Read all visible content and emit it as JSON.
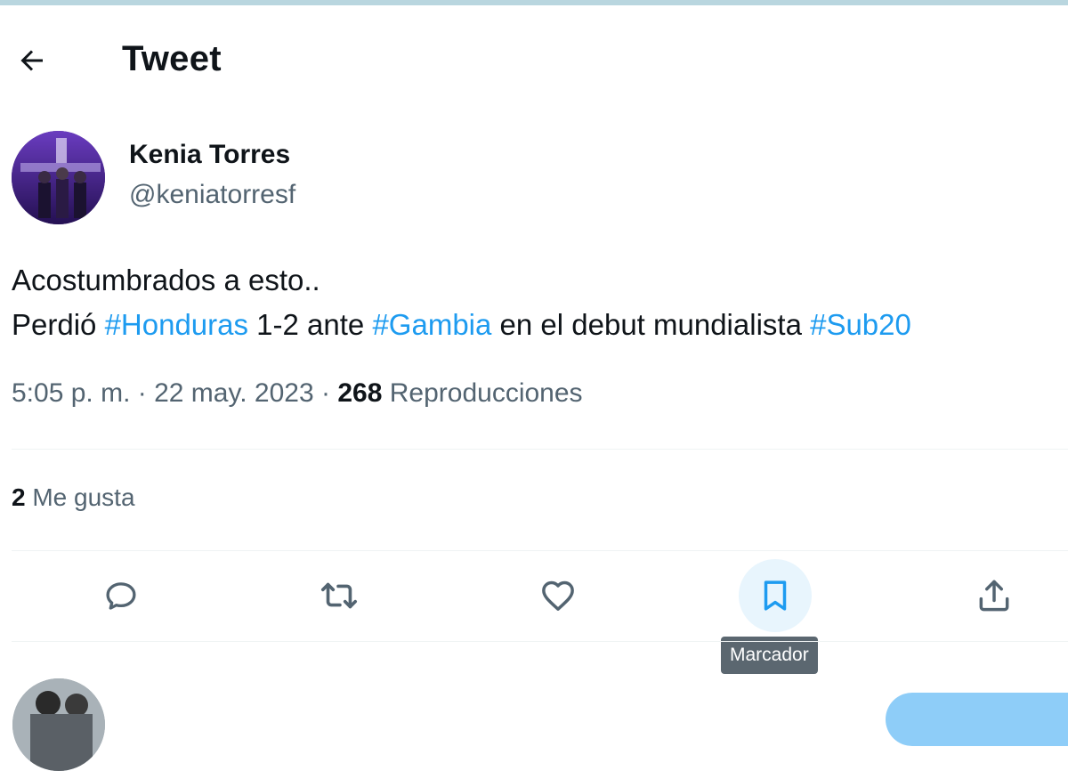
{
  "header": {
    "title": "Tweet"
  },
  "tweet": {
    "author": {
      "name": "Kenia Torres",
      "handle": "@keniatorresf"
    },
    "text": {
      "line1": "Acostumbrados a esto..",
      "line2": [
        {
          "t": "Perdió ",
          "tag": false
        },
        {
          "t": "#Honduras",
          "tag": true
        },
        {
          "t": " 1-2 ante ",
          "tag": false
        },
        {
          "t": "#Gambia",
          "tag": true
        },
        {
          "t": " en el debut mundialista ",
          "tag": false
        },
        {
          "t": "#Sub20",
          "tag": true
        }
      ]
    },
    "meta": {
      "time": "5:05 p. m.",
      "separator": "·",
      "date": "22 may. 2023",
      "views_count": "268",
      "views_label": "Reproducciones"
    },
    "likes": {
      "count": "2",
      "label": "Me gusta"
    }
  },
  "actions": {
    "icons": [
      "reply-icon",
      "retweet-icon",
      "like-icon",
      "bookmark-icon",
      "share-icon"
    ],
    "tooltip": "Marcador"
  },
  "colors": {
    "accent": "#1d9bf0",
    "text": "#0f1419",
    "muted": "#536471",
    "hover_bg": "#e8f5fd",
    "tooltip_bg": "#5b6770"
  }
}
